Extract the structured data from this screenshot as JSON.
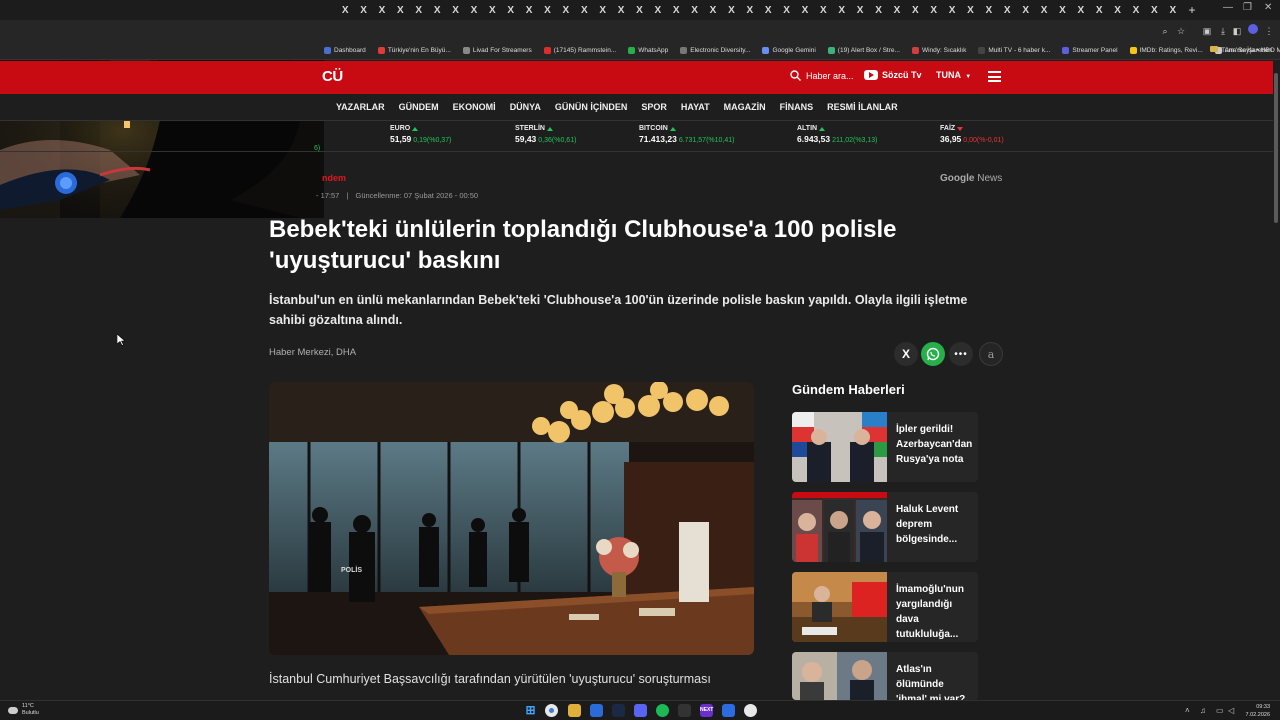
{
  "browser": {
    "tab_close_glyph": "X",
    "tab_count": 46,
    "new_tab_label": "+",
    "bookmarks": [
      {
        "label": "Dashboard",
        "color": "#4a6fd1"
      },
      {
        "label": "Türkiye'nin En Büyü...",
        "color": "#e03a3a"
      },
      {
        "label": "Livad For Streamers",
        "color": "#888888"
      },
      {
        "label": "(17145) Rammstein...",
        "color": "#e02b2b"
      },
      {
        "label": "WhatsApp",
        "color": "#25b04a"
      },
      {
        "label": "Electronic Diversity...",
        "color": "#777777"
      },
      {
        "label": "Google Gemini",
        "color": "#6a8df2"
      },
      {
        "label": "(19) Alert Box / Stre...",
        "color": "#39b37a"
      },
      {
        "label": "Windy: Sıcaklık",
        "color": "#d23d3d"
      },
      {
        "label": "Multi TV - 6 haber k...",
        "color": "#444444"
      },
      {
        "label": "Streamer Panel",
        "color": "#5b5fe0"
      },
      {
        "label": "IMDb: Ratings, Revi...",
        "color": "#f5c518"
      },
      {
        "label": "Ana Sayfa • HBO Max",
        "color": "#cccccc"
      }
    ],
    "bookmarks_overflow": "»",
    "all_bookmarks": "Tüm Yer İşaretleri"
  },
  "site": {
    "logo": "CÜ",
    "search_label": "Haber ara...",
    "tv_label": "Sözcü Tv",
    "user_label": "TUNA",
    "nav": [
      "YAZARLAR",
      "GÜNDEM",
      "EKONOMİ",
      "DÜNYA",
      "GÜNÜN İÇİNDEN",
      "SPOR",
      "HAYAT",
      "MAGAZİN",
      "FİNANS",
      "RESMİ İLANLAR"
    ],
    "tickers": [
      {
        "name": "EURO",
        "value": "51,59",
        "change": "0,19(%0,37)",
        "dir": "up"
      },
      {
        "name": "STERLİN",
        "value": "59,43",
        "change": "0,36(%0,61)",
        "dir": "up"
      },
      {
        "name": "BITCOIN",
        "value": "71.413,23",
        "change": "6.731,57(%10,41)",
        "dir": "up"
      },
      {
        "name": "ALTIN",
        "value": "6.943,53",
        "change": "211,02(%3,13)",
        "dir": "up"
      },
      {
        "name": "FAİZ",
        "value": "36,95",
        "change": "0,00(%-0,01)",
        "dir": "down"
      }
    ],
    "ticker_partial": "6)"
  },
  "article": {
    "section": "ndem",
    "published": "- 17:57",
    "updated": "Güncellenme: 07 Şubat 2026 - 00:50",
    "google_news_g": "Google",
    "google_news_n": "News",
    "headline": "Bebek'teki ünlülerin toplandığı Clubhouse'a 100 polisle 'uyuşturucu' baskını",
    "lede": "İstanbul'un en ünlü mekanlarından Bebek'teki 'Clubhouse'a 100'ün üzerinde polisle baskın yapıldı. Olayla ilgili işletme sahibi gözaltına alındı.",
    "byline": "Haber Merkezi, DHA",
    "share_x": "X",
    "share_more": "•••",
    "share_font": "a",
    "body_start": "İstanbul Cumhuriyet Başsavcılığı tarafından yürütülen 'uyuşturucu' soruşturması",
    "hero_vest_text": "POLİS"
  },
  "sidebar": {
    "title": "Gündem Haberleri",
    "items": [
      {
        "title": "İpler gerildi! Azerbaycan'dan Rusya'ya nota"
      },
      {
        "title": "Haluk Levent deprem bölgesinde..."
      },
      {
        "title": "İmamoğlu'nun yargılandığı dava tutukluluğa..."
      },
      {
        "title": "Atlas'ın ölümünde 'ihmal' mi var?"
      }
    ]
  },
  "taskbar": {
    "temp": "11°C",
    "condition": "Bulutlu",
    "time": "09:33",
    "date": "7.02.2026"
  }
}
